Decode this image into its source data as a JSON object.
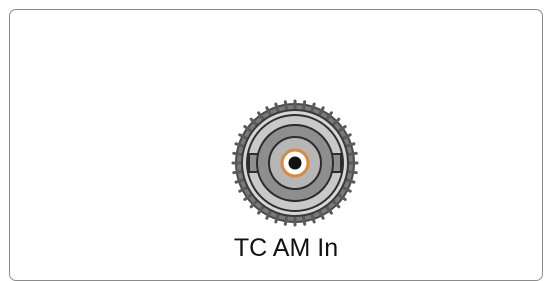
{
  "connector": {
    "label": "TC AM In",
    "icon": "bnc-connector-icon",
    "colors": {
      "outer_dark": "#5f5f5f",
      "outer_light": "#dcdcdc",
      "body": "#c8c8c8",
      "inner": "#8e8e8e",
      "ring": "#b9b9b9",
      "pin_ring": "#ffffff",
      "pin_accent": "#d98a3c",
      "pin": "#111111",
      "outline": "#2c2c2c"
    }
  }
}
